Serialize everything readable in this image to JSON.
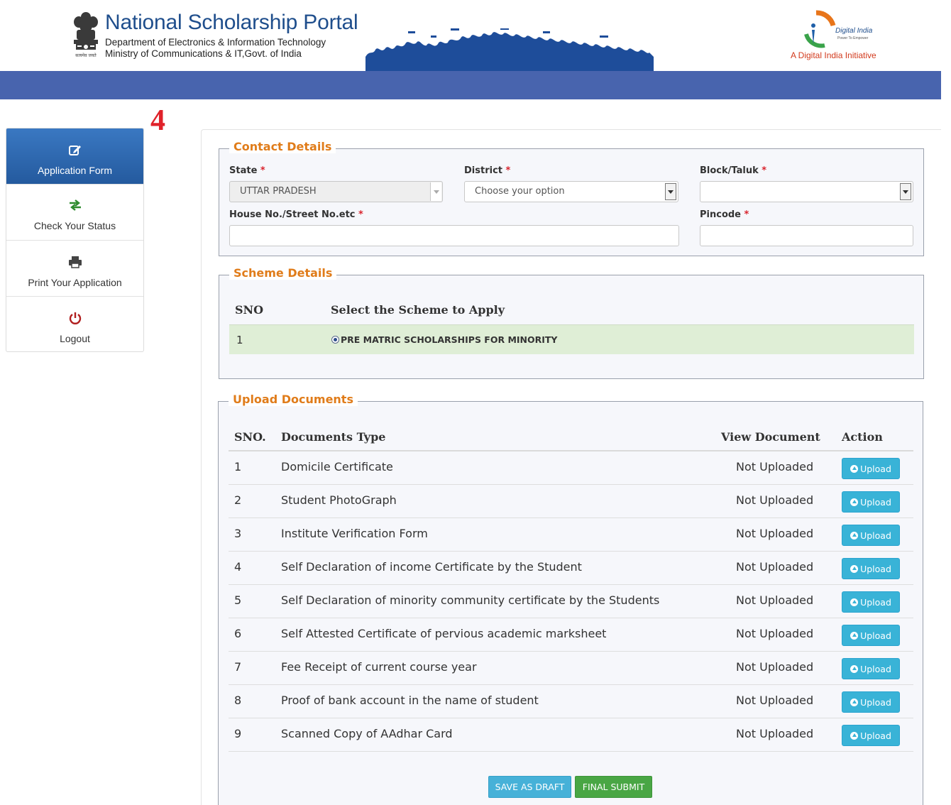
{
  "header": {
    "title": "National Scholarship Portal",
    "department": "Department of Electronics & Information Technology",
    "ministry": "Ministry of Communications & IT,Govt. of India",
    "digital_india_tagline": "A Digital India Initiative",
    "digital_india_logo_text": "Digital India",
    "digital_india_logo_subtext": "Power To Empower",
    "emblem_caption": "सत्यमेव जयते",
    "brand_blue": "#1f4e8c",
    "bar_color": "#4864ae"
  },
  "step_number": "4",
  "sidebar": {
    "items": [
      {
        "label": "Application Form",
        "icon": "edit-icon",
        "active": true
      },
      {
        "label": "Check Your Status",
        "icon": "exchange-arrows-icon",
        "active": false
      },
      {
        "label": "Print Your Application",
        "icon": "printer-icon",
        "active": false
      },
      {
        "label": "Logout",
        "icon": "power-icon",
        "active": false
      }
    ]
  },
  "contact": {
    "legend": "Contact Details",
    "state_label": "State",
    "state_value": "UTTAR PRADESH",
    "district_label": "District",
    "district_value": "Choose your option",
    "block_label": "Block/Taluk",
    "block_value": "",
    "house_label": "House No./Street No.etc",
    "house_value": "",
    "pincode_label": "Pincode",
    "pincode_value": "",
    "required_mark": "*"
  },
  "scheme": {
    "legend": "Scheme Details",
    "col_sno": "SNO",
    "col_select": "Select the Scheme to Apply",
    "rows": [
      {
        "sno": "1",
        "name": "PRE MATRIC SCHOLARSHIPS FOR MINORITY",
        "selected": true
      }
    ]
  },
  "documents": {
    "legend": "Upload Documents",
    "col_sno": "SNO.",
    "col_type": "Documents Type",
    "col_view": "View Document",
    "col_action": "Action",
    "upload_label": "Upload",
    "rows": [
      {
        "sno": "1",
        "type": "Domicile Certificate",
        "status": "Not Uploaded"
      },
      {
        "sno": "2",
        "type": "Student PhotoGraph",
        "status": "Not Uploaded"
      },
      {
        "sno": "3",
        "type": "Institute Verification Form",
        "status": "Not Uploaded"
      },
      {
        "sno": "4",
        "type": "Self Declaration of income Certificate by the Student",
        "status": "Not Uploaded"
      },
      {
        "sno": "5",
        "type": "Self Declaration of minority community certificate by the Students",
        "status": "Not Uploaded"
      },
      {
        "sno": "6",
        "type": "Self Attested Certificate of pervious academic marksheet",
        "status": "Not Uploaded"
      },
      {
        "sno": "7",
        "type": "Fee Receipt of current course year",
        "status": "Not Uploaded"
      },
      {
        "sno": "8",
        "type": "Proof of bank account in the name of student",
        "status": "Not Uploaded"
      },
      {
        "sno": "9",
        "type": "Scanned Copy of AAdhar Card",
        "status": "Not Uploaded"
      }
    ]
  },
  "actions": {
    "save_draft": "SAVE AS DRAFT",
    "final_submit": "FINAL SUBMIT"
  }
}
